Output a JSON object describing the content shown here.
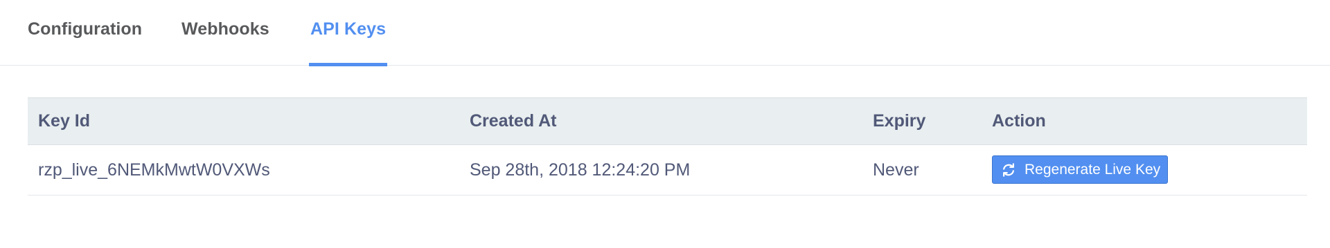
{
  "tabs": [
    {
      "label": "Configuration",
      "active": false
    },
    {
      "label": "Webhooks",
      "active": false
    },
    {
      "label": "API Keys",
      "active": true
    }
  ],
  "table": {
    "headers": [
      "Key Id",
      "Created At",
      "Expiry",
      "Action"
    ],
    "rows": [
      {
        "key_id": "rzp_live_6NEMkMwtW0VXWs",
        "created_at": "Sep 28th, 2018 12:24:20 PM",
        "expiry": "Never",
        "action": {
          "label": "Regenerate Live Key",
          "icon": "refresh-icon"
        }
      }
    ]
  },
  "colors": {
    "accent": "#528ff0",
    "header_bg": "#e9eef0",
    "text": "#515978"
  }
}
